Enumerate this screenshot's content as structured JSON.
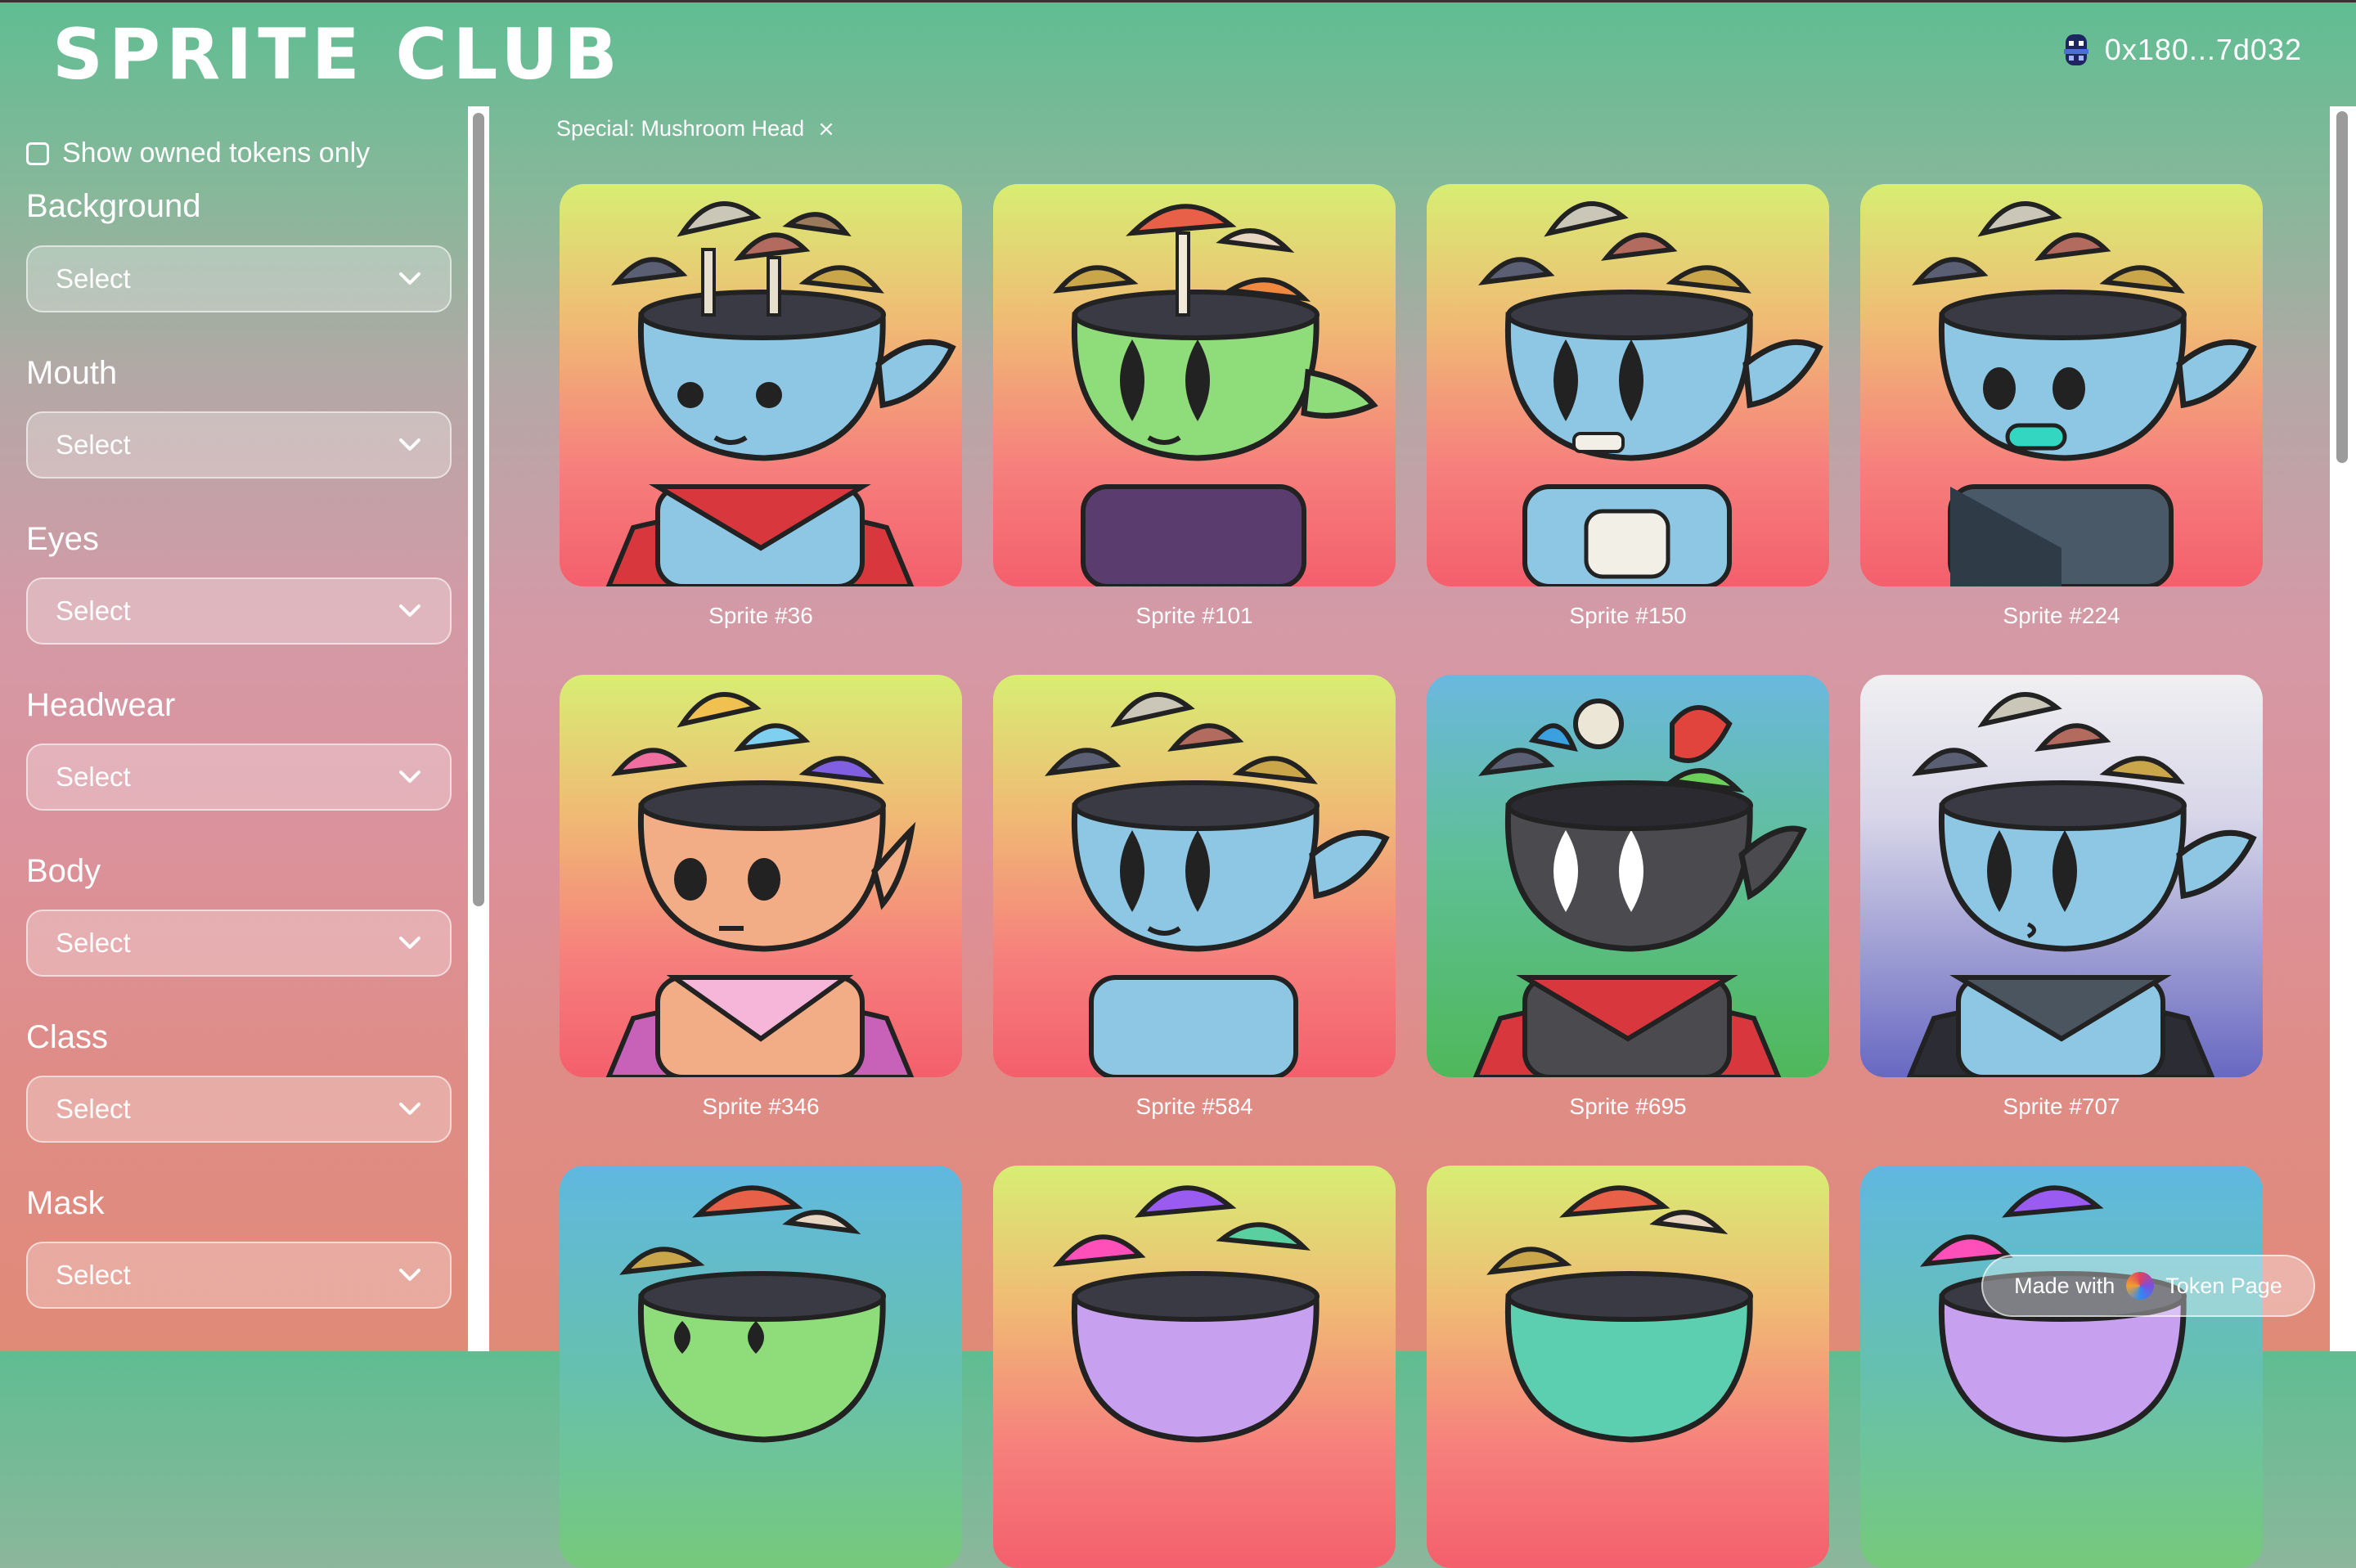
{
  "app": {
    "title": "SPRITE CLUB",
    "wallet_address": "0x180...7d032"
  },
  "sidebar": {
    "owned_only_label": "Show owned tokens only",
    "filters": [
      {
        "label": "Background",
        "value": "Select"
      },
      {
        "label": "Mouth",
        "value": "Select"
      },
      {
        "label": "Eyes",
        "value": "Select"
      },
      {
        "label": "Headwear",
        "value": "Select"
      },
      {
        "label": "Body",
        "value": "Select"
      },
      {
        "label": "Class",
        "value": "Select"
      },
      {
        "label": "Mask",
        "value": "Select"
      }
    ]
  },
  "active_filter": {
    "label": "Special: Mushroom Head",
    "close": "×"
  },
  "tokens": [
    {
      "name": "Sprite #36"
    },
    {
      "name": "Sprite #101"
    },
    {
      "name": "Sprite #150"
    },
    {
      "name": "Sprite #224"
    },
    {
      "name": "Sprite #346"
    },
    {
      "name": "Sprite #584"
    },
    {
      "name": "Sprite #695"
    },
    {
      "name": "Sprite #707"
    }
  ],
  "footer_badge": {
    "prefix": "Made with",
    "brand": "Token Page"
  },
  "colors": {
    "skin_blue": "#8dc7e3",
    "skin_green": "#8fdc7a",
    "skin_peach": "#f2ac86",
    "skin_dark": "#4a4a4f",
    "cape_red": "#d8373e"
  }
}
